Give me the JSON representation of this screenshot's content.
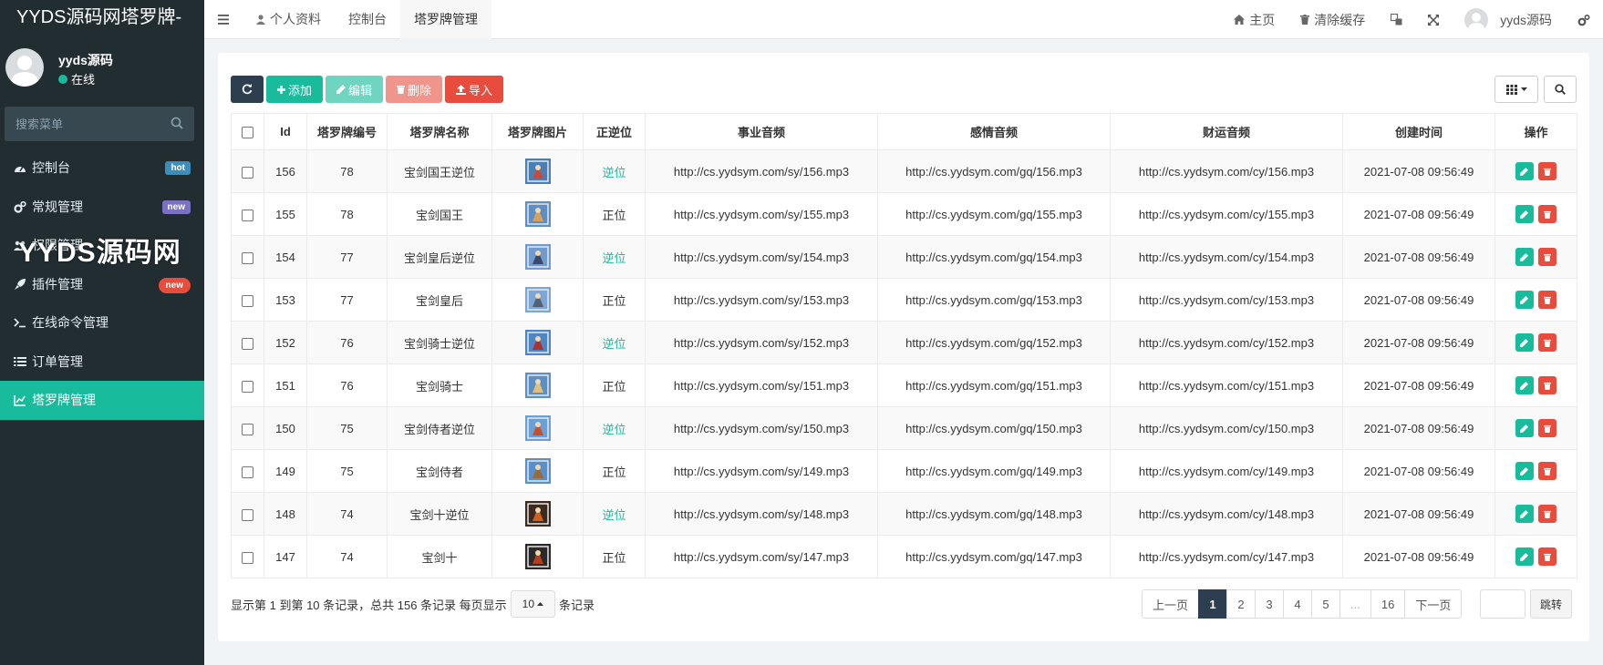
{
  "brand": "YYDS源码网塔罗牌-",
  "user": {
    "name": "yyds源码",
    "status": "在线"
  },
  "search": {
    "placeholder": "搜索菜单"
  },
  "watermark": "YYDS源码网",
  "menu": [
    {
      "label": "控制台",
      "badge": "hot",
      "icon": "dashboard-icon"
    },
    {
      "label": "常规管理",
      "badge": "new",
      "icon": "cogs-icon"
    },
    {
      "label": "权限管理",
      "badge": "",
      "icon": "group-icon"
    },
    {
      "label": "插件管理",
      "badge": "new",
      "icon": "rocket-icon"
    },
    {
      "label": "在线命令管理",
      "badge": "",
      "icon": "terminal-icon"
    },
    {
      "label": "订单管理",
      "badge": "",
      "icon": "list-icon"
    },
    {
      "label": "塔罗牌管理",
      "badge": "",
      "icon": "chart-icon",
      "active": true
    }
  ],
  "topnav": {
    "tabs": [
      "个人资料",
      "控制台",
      "塔罗牌管理"
    ],
    "home": "主页",
    "clear_cache": "清除缓存",
    "username": "yyds源码"
  },
  "toolbar": {
    "add": "添加",
    "edit": "编辑",
    "delete": "删除",
    "import": "导入"
  },
  "table": {
    "headers": [
      "Id",
      "塔罗牌编号",
      "塔罗牌名称",
      "塔罗牌图片",
      "正逆位",
      "事业音频",
      "感情音频",
      "财运音频",
      "创建时间",
      "操作"
    ],
    "rows": [
      {
        "id": "156",
        "no": "78",
        "name": "宝剑国王逆位",
        "pos": "逆位",
        "sy": "http://cs.yydsym.com/sy/156.mp3",
        "gq": "http://cs.yydsym.com/gq/156.mp3",
        "cy": "http://cs.yydsym.com/cy/156.mp3",
        "time": "2021-07-08 09:56:49"
      },
      {
        "id": "155",
        "no": "78",
        "name": "宝剑国王",
        "pos": "正位",
        "sy": "http://cs.yydsym.com/sy/155.mp3",
        "gq": "http://cs.yydsym.com/gq/155.mp3",
        "cy": "http://cs.yydsym.com/cy/155.mp3",
        "time": "2021-07-08 09:56:49"
      },
      {
        "id": "154",
        "no": "77",
        "name": "宝剑皇后逆位",
        "pos": "逆位",
        "sy": "http://cs.yydsym.com/sy/154.mp3",
        "gq": "http://cs.yydsym.com/gq/154.mp3",
        "cy": "http://cs.yydsym.com/cy/154.mp3",
        "time": "2021-07-08 09:56:49"
      },
      {
        "id": "153",
        "no": "77",
        "name": "宝剑皇后",
        "pos": "正位",
        "sy": "http://cs.yydsym.com/sy/153.mp3",
        "gq": "http://cs.yydsym.com/gq/153.mp3",
        "cy": "http://cs.yydsym.com/cy/153.mp3",
        "time": "2021-07-08 09:56:49"
      },
      {
        "id": "152",
        "no": "76",
        "name": "宝剑骑士逆位",
        "pos": "逆位",
        "sy": "http://cs.yydsym.com/sy/152.mp3",
        "gq": "http://cs.yydsym.com/gq/152.mp3",
        "cy": "http://cs.yydsym.com/cy/152.mp3",
        "time": "2021-07-08 09:56:49"
      },
      {
        "id": "151",
        "no": "76",
        "name": "宝剑骑士",
        "pos": "正位",
        "sy": "http://cs.yydsym.com/sy/151.mp3",
        "gq": "http://cs.yydsym.com/gq/151.mp3",
        "cy": "http://cs.yydsym.com/cy/151.mp3",
        "time": "2021-07-08 09:56:49"
      },
      {
        "id": "150",
        "no": "75",
        "name": "宝剑侍者逆位",
        "pos": "逆位",
        "sy": "http://cs.yydsym.com/sy/150.mp3",
        "gq": "http://cs.yydsym.com/gq/150.mp3",
        "cy": "http://cs.yydsym.com/cy/150.mp3",
        "time": "2021-07-08 09:56:49"
      },
      {
        "id": "149",
        "no": "75",
        "name": "宝剑侍者",
        "pos": "正位",
        "sy": "http://cs.yydsym.com/sy/149.mp3",
        "gq": "http://cs.yydsym.com/gq/149.mp3",
        "cy": "http://cs.yydsym.com/cy/149.mp3",
        "time": "2021-07-08 09:56:49"
      },
      {
        "id": "148",
        "no": "74",
        "name": "宝剑十逆位",
        "pos": "逆位",
        "sy": "http://cs.yydsym.com/sy/148.mp3",
        "gq": "http://cs.yydsym.com/gq/148.mp3",
        "cy": "http://cs.yydsym.com/cy/148.mp3",
        "time": "2021-07-08 09:56:49"
      },
      {
        "id": "147",
        "no": "74",
        "name": "宝剑十",
        "pos": "正位",
        "sy": "http://cs.yydsym.com/sy/147.mp3",
        "gq": "http://cs.yydsym.com/gq/147.mp3",
        "cy": "http://cs.yydsym.com/cy/147.mp3",
        "time": "2021-07-08 09:56:49"
      }
    ]
  },
  "footer": {
    "summary": "显示第 1 到第 10 条记录，总共 156 条记录 每页显示",
    "page_size": "10",
    "suffix": "条记录"
  },
  "pager": [
    "上一页",
    "1",
    "2",
    "3",
    "4",
    "5",
    "...",
    "16",
    "下一页"
  ],
  "jump_label": "跳转",
  "colors": {
    "accent": "#18bc9c",
    "sidebar": "#222d32",
    "danger": "#e74c3c",
    "dark": "#2c3e50"
  }
}
